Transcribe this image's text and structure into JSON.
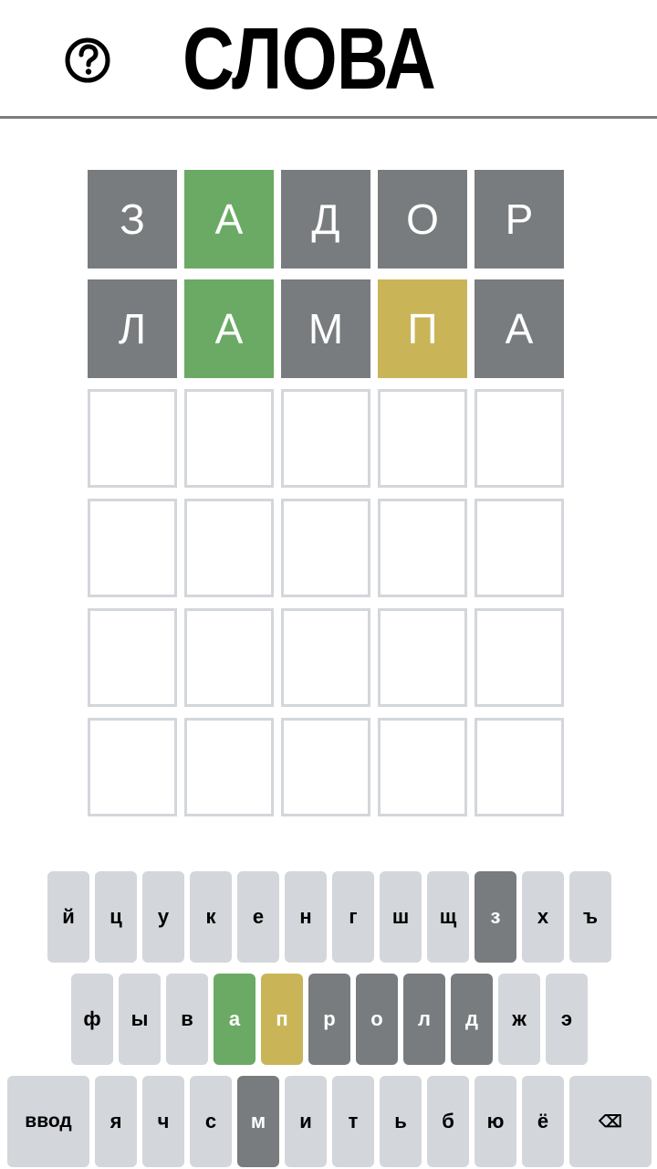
{
  "header": {
    "help_icon": "question-circle-icon",
    "title": "СЛОВА"
  },
  "colors": {
    "correct": "#6aaa64",
    "present": "#c9b458",
    "absent": "#787c7e",
    "empty_border": "#d3d6da",
    "key_default": "#d3d6da"
  },
  "board": {
    "rows": [
      [
        {
          "letter": "З",
          "state": "absent"
        },
        {
          "letter": "А",
          "state": "correct"
        },
        {
          "letter": "Д",
          "state": "absent"
        },
        {
          "letter": "О",
          "state": "absent"
        },
        {
          "letter": "Р",
          "state": "absent"
        }
      ],
      [
        {
          "letter": "Л",
          "state": "absent"
        },
        {
          "letter": "А",
          "state": "correct"
        },
        {
          "letter": "М",
          "state": "absent"
        },
        {
          "letter": "П",
          "state": "present"
        },
        {
          "letter": "А",
          "state": "absent"
        }
      ],
      [
        {
          "letter": "",
          "state": "empty"
        },
        {
          "letter": "",
          "state": "empty"
        },
        {
          "letter": "",
          "state": "empty"
        },
        {
          "letter": "",
          "state": "empty"
        },
        {
          "letter": "",
          "state": "empty"
        }
      ],
      [
        {
          "letter": "",
          "state": "empty"
        },
        {
          "letter": "",
          "state": "empty"
        },
        {
          "letter": "",
          "state": "empty"
        },
        {
          "letter": "",
          "state": "empty"
        },
        {
          "letter": "",
          "state": "empty"
        }
      ],
      [
        {
          "letter": "",
          "state": "empty"
        },
        {
          "letter": "",
          "state": "empty"
        },
        {
          "letter": "",
          "state": "empty"
        },
        {
          "letter": "",
          "state": "empty"
        },
        {
          "letter": "",
          "state": "empty"
        }
      ],
      [
        {
          "letter": "",
          "state": "empty"
        },
        {
          "letter": "",
          "state": "empty"
        },
        {
          "letter": "",
          "state": "empty"
        },
        {
          "letter": "",
          "state": "empty"
        },
        {
          "letter": "",
          "state": "empty"
        }
      ]
    ]
  },
  "keyboard": {
    "rows": [
      [
        {
          "label": "й",
          "state": "default"
        },
        {
          "label": "ц",
          "state": "default"
        },
        {
          "label": "у",
          "state": "default"
        },
        {
          "label": "к",
          "state": "default"
        },
        {
          "label": "е",
          "state": "default"
        },
        {
          "label": "н",
          "state": "default"
        },
        {
          "label": "г",
          "state": "default"
        },
        {
          "label": "ш",
          "state": "default"
        },
        {
          "label": "щ",
          "state": "default"
        },
        {
          "label": "з",
          "state": "absent"
        },
        {
          "label": "х",
          "state": "default"
        },
        {
          "label": "ъ",
          "state": "default"
        }
      ],
      [
        {
          "label": "ф",
          "state": "default"
        },
        {
          "label": "ы",
          "state": "default"
        },
        {
          "label": "в",
          "state": "default"
        },
        {
          "label": "а",
          "state": "correct"
        },
        {
          "label": "п",
          "state": "present"
        },
        {
          "label": "р",
          "state": "absent"
        },
        {
          "label": "о",
          "state": "absent"
        },
        {
          "label": "л",
          "state": "absent"
        },
        {
          "label": "д",
          "state": "absent"
        },
        {
          "label": "ж",
          "state": "default"
        },
        {
          "label": "э",
          "state": "default"
        }
      ],
      [
        {
          "label": "ввод",
          "state": "default",
          "kind": "enter"
        },
        {
          "label": "я",
          "state": "default"
        },
        {
          "label": "ч",
          "state": "default"
        },
        {
          "label": "с",
          "state": "default"
        },
        {
          "label": "м",
          "state": "absent"
        },
        {
          "label": "и",
          "state": "default"
        },
        {
          "label": "т",
          "state": "default"
        },
        {
          "label": "ь",
          "state": "default"
        },
        {
          "label": "б",
          "state": "default"
        },
        {
          "label": "ю",
          "state": "default"
        },
        {
          "label": "ё",
          "state": "default"
        },
        {
          "label": "⌫",
          "state": "default",
          "kind": "backspace",
          "icon": "backspace-icon"
        }
      ]
    ]
  }
}
